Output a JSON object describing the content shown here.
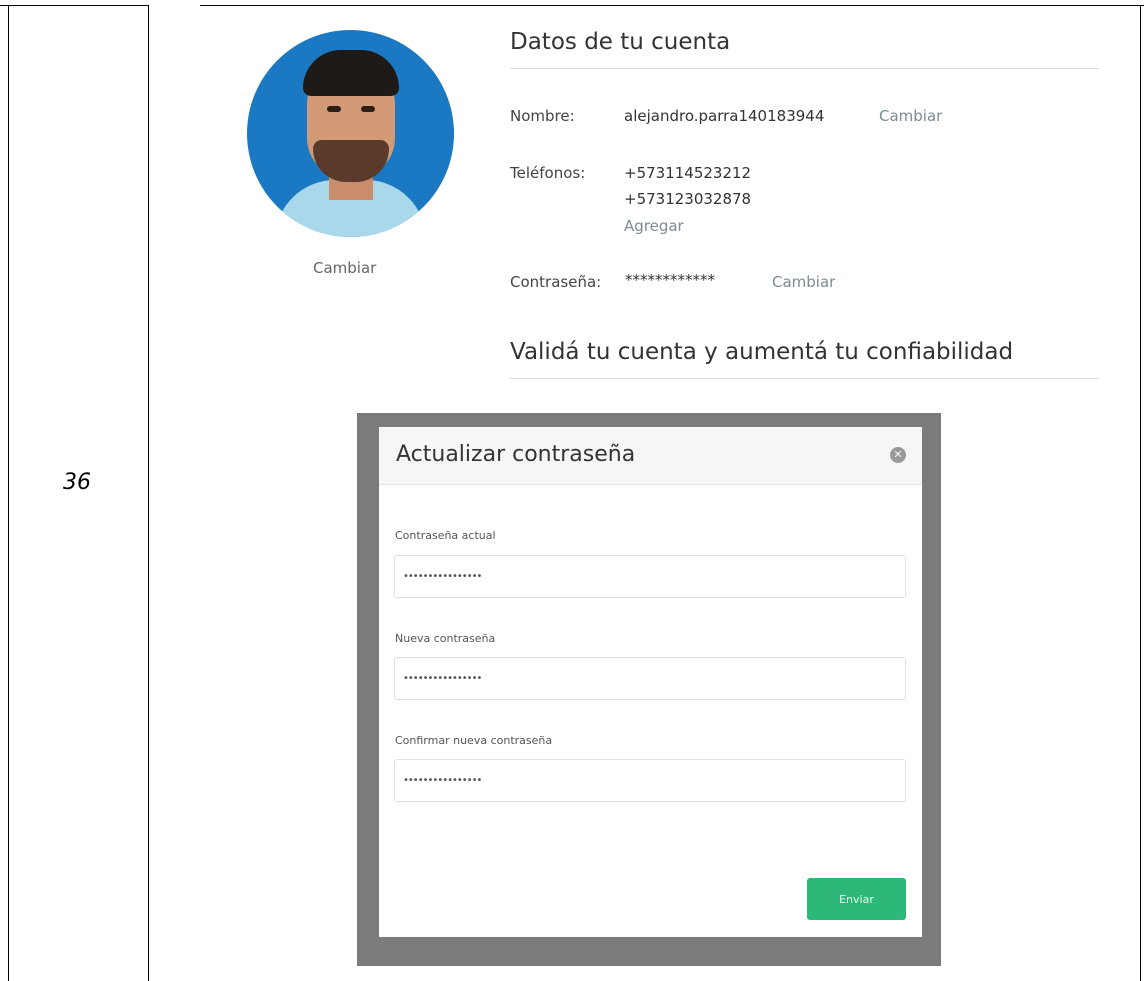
{
  "row_number": "36",
  "avatar": {
    "change_label": "Cambiar"
  },
  "account": {
    "title": "Datos de tu cuenta",
    "name_label": "Nombre:",
    "name_value": "alejandro.parra140183944",
    "name_change": "Cambiar",
    "phones_label": "Teléfonos:",
    "phones": [
      "+573114523212",
      "+573123032878"
    ],
    "phones_add": "Agregar",
    "password_label": "Contraseña:",
    "password_value": "************",
    "password_change": "Cambiar"
  },
  "validate": {
    "title": "Validá tu cuenta y aumentá tu confiabilidad"
  },
  "modal": {
    "title": "Actualizar contraseña",
    "close_icon": "close-circle-icon",
    "current_label": "Contraseña actual",
    "current_value": "••••••••••••••••",
    "new_label": "Nueva contraseña",
    "new_value": "••••••••••••••••",
    "confirm_label": "Confirmar nueva contraseña",
    "confirm_value": "••••••••••••••••",
    "submit": "Enviar",
    "colors": {
      "submit": "#2db87a",
      "overlay": "#7b7b7b"
    }
  }
}
